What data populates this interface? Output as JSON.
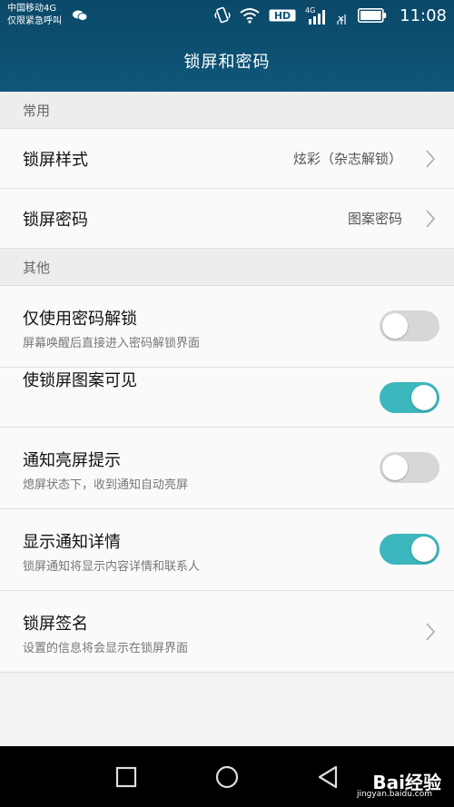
{
  "status_bar": {
    "carrier": "中国移动4G",
    "emergency": "仅限紧急呼叫",
    "network": "4G",
    "hd": "HD",
    "time": "11:08"
  },
  "header": {
    "title": "锁屏和密码"
  },
  "sections": {
    "common": {
      "label": "常用",
      "lock_style": {
        "label": "锁屏样式",
        "value": "炫彩（杂志解锁）"
      },
      "lock_password": {
        "label": "锁屏密码",
        "value": "图案密码"
      }
    },
    "other": {
      "label": "其他",
      "password_only": {
        "label": "仅使用密码解锁",
        "desc": "屏幕唤醒后直接进入密码解锁界面",
        "enabled": false
      },
      "pattern_visible": {
        "label": "使锁屏图案可见",
        "enabled": true
      },
      "notify_wake": {
        "label": "通知亮屏提示",
        "desc": "熄屏状态下，收到通知自动亮屏",
        "enabled": false
      },
      "show_details": {
        "label": "显示通知详情",
        "desc": "锁屏通知将显示内容详情和联系人",
        "enabled": true
      },
      "signature": {
        "label": "锁屏签名",
        "desc": "设置的信息将会显示在锁屏界面"
      }
    }
  },
  "watermark": {
    "brand": "Bai经验",
    "url": "jingyan.baidu.com"
  },
  "colors": {
    "header": "#0e5779",
    "toggle_on": "#3cb7bd",
    "toggle_off": "#d7d7d7"
  }
}
